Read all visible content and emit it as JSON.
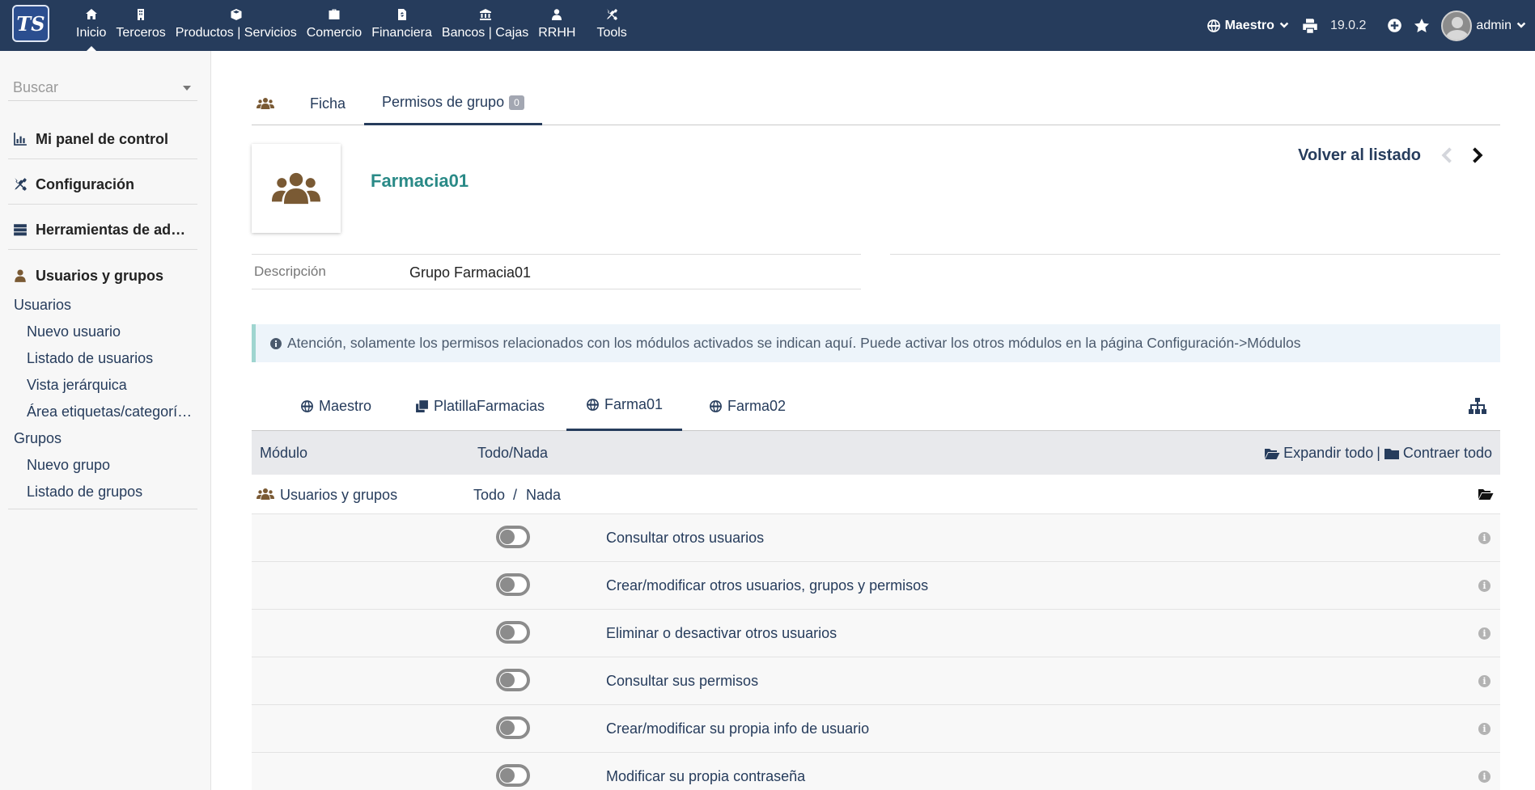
{
  "topbar": {
    "logo": "TS",
    "menu": [
      {
        "label": "Inicio",
        "icon": "home-icon"
      },
      {
        "label": "Terceros",
        "icon": "building-icon"
      },
      {
        "label": "Productos | Servicios",
        "icon": "cube-icon"
      },
      {
        "label": "Comercio",
        "icon": "briefcase-icon"
      },
      {
        "label": "Financiera",
        "icon": "invoice-icon"
      },
      {
        "label": "Bancos | Cajas",
        "icon": "bank-icon"
      },
      {
        "label": "RRHH",
        "icon": "person-icon"
      },
      {
        "label": "Tools",
        "icon": "tools-icon"
      }
    ],
    "entity": "Maestro",
    "version": "19.0.2",
    "user": "admin"
  },
  "sidebar": {
    "search_placeholder": "Buscar",
    "sections": {
      "dashboard": "Mi panel de control",
      "setup": "Configuración",
      "admin_tools": "Herramientas de ad…",
      "users_groups": "Usuarios y grupos"
    },
    "links": {
      "users": "Usuarios",
      "new_user": "Nuevo usuario",
      "user_list": "Listado de usuarios",
      "hierarchy": "Vista jerárquica",
      "tags": "Área etiquetas/categorí…",
      "groups": "Grupos",
      "new_group": "Nuevo grupo",
      "group_list": "Listado de grupos"
    }
  },
  "main": {
    "tabs": {
      "card": "Ficha",
      "perms": "Permisos de grupo",
      "perms_count": "0"
    },
    "group_name": "Farmacia01",
    "back_link": "Volver al listado",
    "description_label": "Descripción",
    "description_value": "Grupo Farmacia01",
    "info_text": "Atención, solamente los permisos relacionados con los módulos activados se indican aquí. Puede activar los otros módulos en la página Configuración->Módulos",
    "entity_tabs": [
      "Maestro",
      "PlatillaFarmacias",
      "Farma01",
      "Farma02"
    ],
    "table": {
      "col_module": "Módulo",
      "col_all_none": "Todo/Nada",
      "expand_all": "Expandir todo",
      "separator": "|",
      "collapse_all": "Contraer todo"
    },
    "module": {
      "name": "Usuarios y grupos",
      "all": "Todo",
      "slash": "/",
      "none": "Nada"
    },
    "permissions": [
      {
        "label": "Consultar otros usuarios",
        "enabled": false
      },
      {
        "label": "Crear/modificar otros usuarios, grupos y permisos",
        "enabled": false
      },
      {
        "label": "Eliminar o desactivar otros usuarios",
        "enabled": false
      },
      {
        "label": "Consultar sus permisos",
        "enabled": false
      },
      {
        "label": "Crear/modificar su propia info de usuario",
        "enabled": false
      },
      {
        "label": "Modificar su propia contraseña",
        "enabled": false
      }
    ]
  },
  "colors": {
    "topbar": "#263c5c",
    "accent_title": "#2a8a87",
    "icon_brown": "#7a5a34",
    "info_bg": "#edf4fa"
  }
}
